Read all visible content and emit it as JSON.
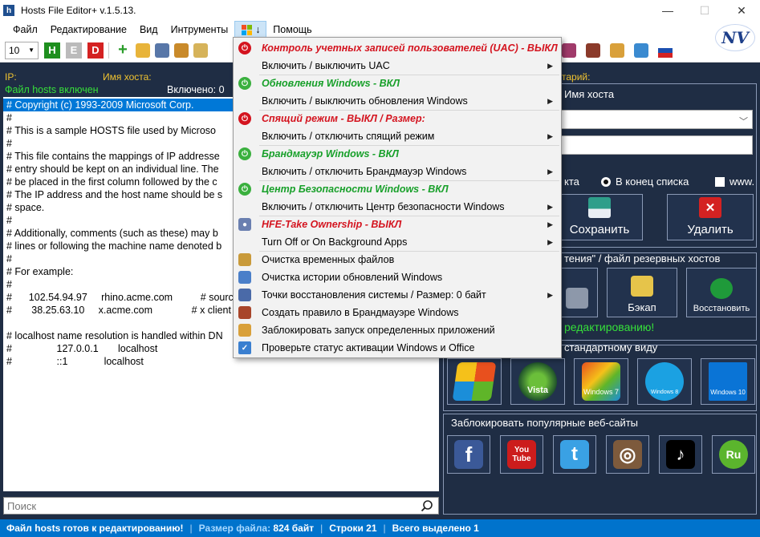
{
  "window": {
    "title": "Hosts File Editor+ v.1.5.13.",
    "app_icon_letter": "h",
    "minimize": "—",
    "maximize": "☐",
    "close": "✕"
  },
  "menu": {
    "file": "Файл",
    "edit": "Редактирование",
    "view": "Вид",
    "tools": "Интрументы",
    "windows_menu": "↓",
    "help": "Помощь"
  },
  "toolbar": {
    "font_size": "10",
    "h_label": "H",
    "e_label": "E",
    "d_label": "D",
    "plus_label": "+",
    "logo": "NV"
  },
  "left": {
    "col_ip": "IP:",
    "col_host": "Имя хоста:",
    "status": "Файл hosts включен",
    "enabled_count": "Включено: 0"
  },
  "editor_lines": [
    "# Copyright (c) 1993-2009 Microsoft Corp.",
    "#",
    "# This is a sample HOSTS file used by Microso",
    "#",
    "# This file contains the mappings of IP addresse",
    "# entry should be kept on an individual line. The",
    "# be placed in the first column followed by the c",
    "# The IP address and the host name should be s",
    "# space.",
    "#",
    "# Additionally, comments (such as these) may b",
    "# lines or following the machine name denoted b",
    "#",
    "# For example:",
    "#",
    "#      102.54.94.97     rhino.acme.com          # sourc",
    "#       38.25.63.10     x.acme.com              # x client h",
    "",
    "# localhost name resolution is handled within DN",
    "#                127.0.0.1       localhost",
    "#                ::1             localhost"
  ],
  "search": {
    "placeholder": "Поиск"
  },
  "statusbar": {
    "ready": "Файл hosts готов к редактированию!",
    "size_label": "Размер файла:",
    "size_value": "824 байт",
    "lines": "Строки 21",
    "selected": "Всего выделено 1",
    "sep": "|"
  },
  "right": {
    "comment_hdr": "тарий:",
    "host_name_title": "Имя хоста",
    "radio_partial": "кта",
    "radio_end": "В конец списка",
    "checkbox_www": "www.",
    "save": "Сохранить",
    "delete": "Удалить",
    "backup_title": "тения\" / файл резервных хостов",
    "backup": "Бэкап",
    "restore": "Восстановить",
    "ready_edit": "редактированию!",
    "default_title": "стандартному виду",
    "os_xp": "",
    "os_vista": "Vista",
    "os_win7": "Windows 7",
    "os_win8": "Windows 8",
    "os_win10": "Windows 10",
    "block_title": "Заблокировать популярные веб-сайты",
    "site_fb": "f",
    "site_yt": "You\nTube",
    "site_tw": "t",
    "site_ig": "◎",
    "site_tt": "♪",
    "site_ru": "Ru"
  },
  "dropdown": {
    "uac_status": "Контроль учетных записей пользователей (UAC) - ВЫКЛ",
    "uac_toggle": "Включить / выключить UAC",
    "updates_status": "Обновления Windows - ВКЛ",
    "updates_toggle": "Включить / выключить обновления Windows",
    "sleep_status": "Спящий режим - ВЫКЛ / Размер:",
    "sleep_toggle": "Включить / отключить спящий режим",
    "firewall_status": "Брандмауэр Windows - ВКЛ",
    "firewall_toggle": "Включить / отключить Брандмауэр Windows",
    "security_status": "Центр Безопасности Windows - ВКЛ",
    "security_toggle": "Включить / отключить Центр безопасности Windows",
    "ownership": "HFE-Take Ownership - ВЫКЛ",
    "bg_apps": "Turn Off or On Background Apps",
    "temp_clean": "Очистка временных файлов",
    "update_history": "Очистка истории обновлений Windows",
    "restore_points": "Точки восстановления системы / Размер: 0 байт",
    "firewall_rule": "Создать правило в Брандмауэре Windows",
    "block_apps": "Заблокировать запуск определенных приложений",
    "activation": "Проверьте статус активации Windows и Office"
  },
  "colors": {
    "background": "#1f2d44",
    "accent_red": "#d4141f",
    "accent_green": "#18a02a",
    "status_blue": "#0073cc",
    "header_yellow": "#f0c330"
  }
}
